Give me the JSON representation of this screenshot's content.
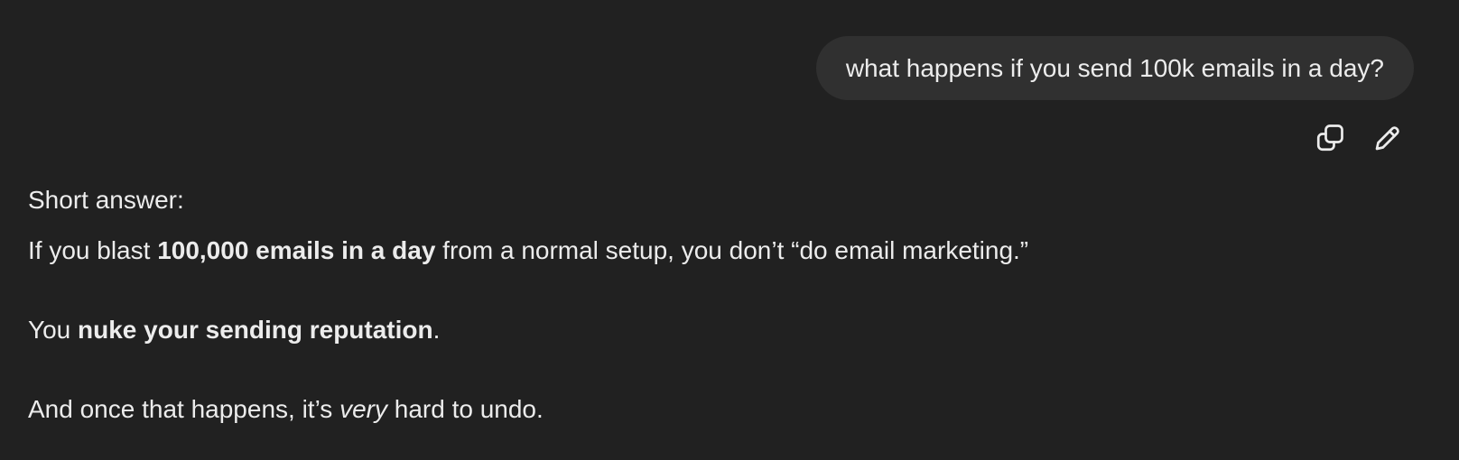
{
  "conversation": {
    "user_message": {
      "text": "what happens if you send 100k emails in a day?",
      "actions": [
        {
          "icon": "copy-icon"
        },
        {
          "icon": "edit-icon"
        }
      ]
    },
    "assistant_message": {
      "line1": "Short answer:",
      "line2_prefix": "If you blast ",
      "line2_bold": "100,000 emails in a day",
      "line2_suffix": " from a normal setup, you don’t “do email marketing.”",
      "line3_prefix": "You ",
      "line3_bold": "nuke your sending reputation",
      "line3_suffix": ".",
      "line4_prefix": "And once that happens, it’s ",
      "line4_italic": "very",
      "line4_suffix": " hard to undo."
    }
  },
  "colors": {
    "background": "#212121",
    "bubble": "#303030",
    "text": "#ececec"
  }
}
